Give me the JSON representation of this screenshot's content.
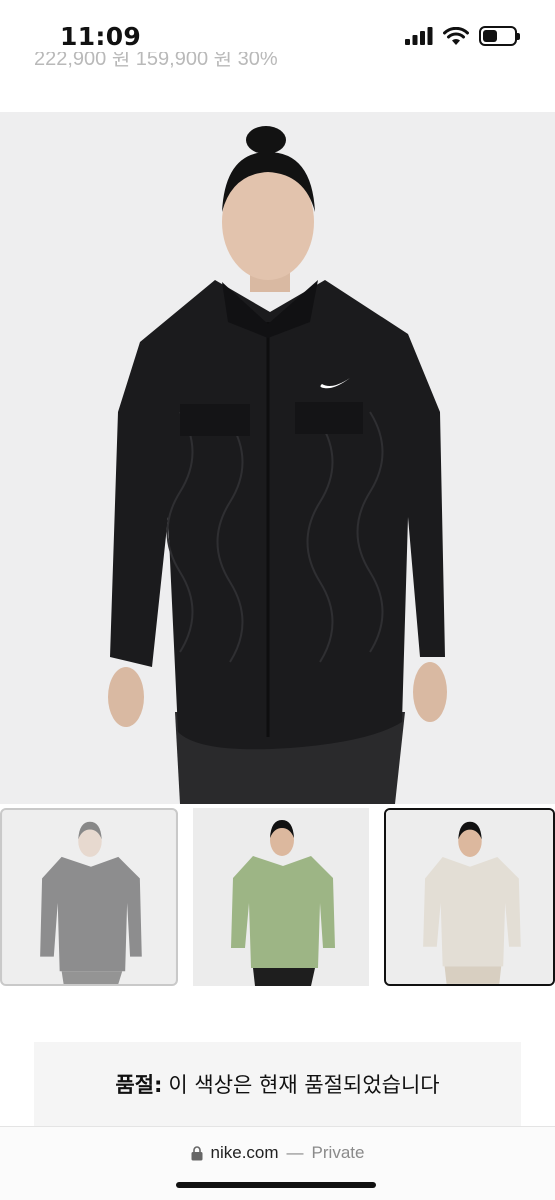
{
  "status_bar": {
    "time": "11:09",
    "icons": [
      "cellular-signal-icon",
      "wifi-icon",
      "battery-icon"
    ],
    "battery_level": 0.45
  },
  "price_row": {
    "text_visible": "222,900 원  159,900 원  30%",
    "colors": {
      "muted": "#b9b9b9",
      "discount": "#2b9a47"
    }
  },
  "product": {
    "main_image": "black-quilted-shirt-jacket-photo",
    "colors": {
      "background": "#eeeeef",
      "jacket": "#1b1b1d"
    }
  },
  "variants": [
    {
      "color_name": "black",
      "selected": false,
      "sold_out": true
    },
    {
      "color_name": "sage-green",
      "selected": false,
      "sold_out": false
    },
    {
      "color_name": "light-bone",
      "selected": true,
      "sold_out": false
    }
  ],
  "notice": {
    "label": "품절:",
    "message": "이 색상은 현재 품절되었습니다"
  },
  "browser": {
    "domain": "nike.com",
    "separator": "—",
    "mode": "Private"
  }
}
